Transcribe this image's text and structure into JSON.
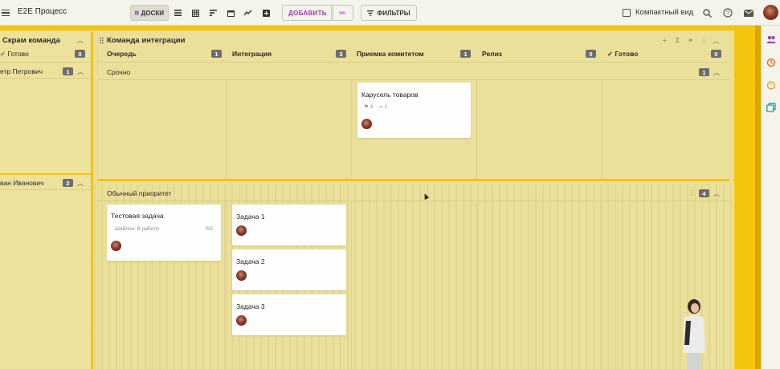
{
  "app": {
    "title": "E2E Процесс"
  },
  "toolbar": {
    "boards_label": "ДОСКИ",
    "add_label": "ДОБАВИТЬ",
    "add_dropdown_glyph": "═",
    "filters_label": "ФИЛЬТРЫ",
    "compact_label": "Компактный вид",
    "view_icons": [
      "boards-icon",
      "list-icon",
      "table-icon",
      "sort-icon",
      "calendar-icon",
      "chart-icon",
      "add-box-icon"
    ]
  },
  "left_column": {
    "title": "Скрам команда",
    "done_label": "✓ Готово",
    "done_count": "0",
    "lanes": [
      {
        "name": "етр Петрович",
        "count": "1"
      },
      {
        "name": "ван Иванович",
        "count": "2"
      }
    ]
  },
  "board": {
    "title": "Команда интеграции",
    "columns": [
      {
        "label": "Очередь",
        "count": "1"
      },
      {
        "label": "Интеграция",
        "count": "3"
      },
      {
        "label": "Приемка комитетом",
        "count": "1"
      },
      {
        "label": "Релиз",
        "count": "0"
      },
      {
        "label": "✓ Готово",
        "count": "0"
      }
    ],
    "lanes": [
      {
        "title": "Срочно",
        "count": "1"
      },
      {
        "title": "Обычный приоритет",
        "count": "4"
      }
    ],
    "cards": {
      "carousel": {
        "title": "Карусель товаров",
        "meta_a": "4",
        "meta_b": "1"
      },
      "test": {
        "title": "Тестовая задача",
        "meta": "Шаблон: В работе",
        "progress": "0/2"
      },
      "task1": {
        "title": "Задача 1"
      },
      "task2": {
        "title": "Задача 2"
      },
      "task3": {
        "title": "Задача 3"
      }
    }
  },
  "colors": {
    "accent_yellow": "#f2c31b",
    "board_bg": "#ebe09a",
    "brand_purple": "#9b3ca8"
  }
}
